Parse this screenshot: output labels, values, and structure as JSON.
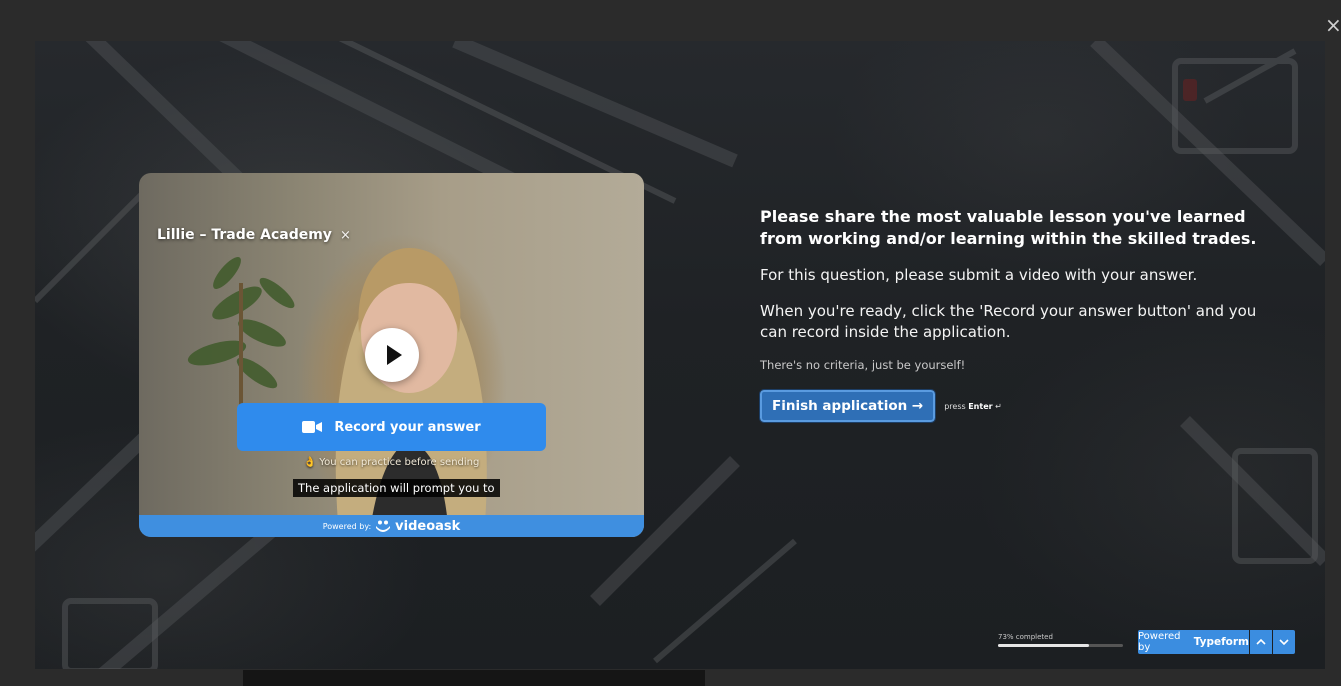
{
  "window": {
    "close_icon": "close-icon",
    "close_glyph": "×"
  },
  "video": {
    "title": "Lillie – Trade Academy",
    "title_close": "×",
    "play_icon": "play-icon",
    "record_label": "Record your answer",
    "record_icon": "video-camera-icon",
    "practice_emoji": "👌",
    "practice_text": "You can practice before sending",
    "subtitle": "The application will prompt you to",
    "powered_prefix": "Powered by:",
    "powered_brand": "videoask",
    "colors": {
      "record": "#2f8bed",
      "powered_bar": "#3f8fe0"
    }
  },
  "question": {
    "title": "Please share the most valuable lesson you've learned from working and/or learning within the skilled trades.",
    "paragraph_1": "For this question, please submit a video with your answer.",
    "paragraph_2": "When you're ready, click the 'Record your answer button' and you can record inside the application.",
    "note": "There's no criteria, just be yourself!",
    "finish_label": "Finish application →",
    "press_prefix": "press",
    "press_key": "Enter",
    "press_glyph": "↵"
  },
  "footer": {
    "progress_label": "73% completed",
    "progress_percent": 73,
    "powered_prefix": "Powered by",
    "powered_brand": "Typeform",
    "nav_up_glyph": "⌃",
    "nav_down_glyph": "⌄",
    "colors": {
      "accent": "#3b8de0"
    }
  }
}
